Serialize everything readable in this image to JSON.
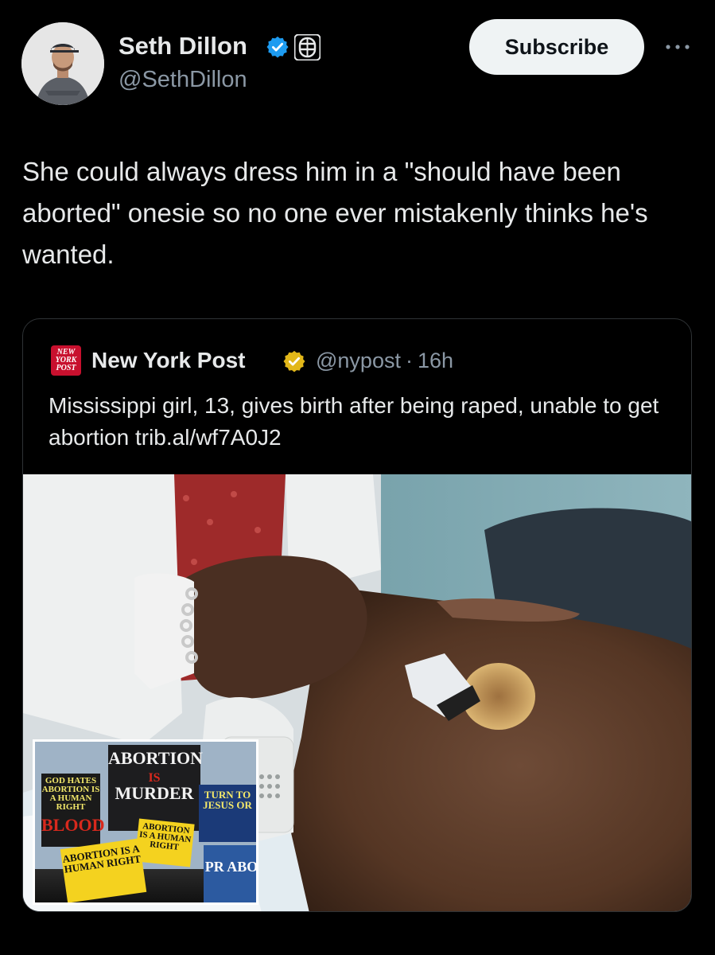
{
  "author": {
    "name": "Seth Dillon",
    "handle": "@SethDillon",
    "verified_icon": "verified-badge-blue",
    "affiliation_icon": "babylon-bee-affiliate-badge",
    "avatar": "profile-photo"
  },
  "header": {
    "subscribe_label": "Subscribe",
    "more_icon": "more-horizontal-icon"
  },
  "tweet": {
    "text": "She could always dress him in a \"should have been aborted\" onesie so no one ever mistakenly thinks he's wanted."
  },
  "quoted": {
    "logo_text": "NEW YORK POST",
    "name": "New York Post",
    "verified_icon": "verified-badge-gold",
    "handle": "@nypost",
    "separator": "·",
    "time": "16h",
    "text": "Mississippi girl, 13, gives birth after being raped, unable to get abortion trib.al/wf7A0J2",
    "image": {
      "inset_signs": {
        "main_top": "ABORTION",
        "main_mid": "IS",
        "main_bottom": "MURDER",
        "left_top": "GOD HATES",
        "left_body": "ABORTION IS A HUMAN RIGHT",
        "left_bottom": "BLOOD",
        "right": "TURN TO JESUS OR",
        "yellow_front": "ABORTION IS A HUMAN RIGHT",
        "yellow_back": "ABORTION IS A HUMAN RIGHT",
        "blue_bottom": "PR ABO"
      }
    }
  },
  "colors": {
    "background": "#000000",
    "text": "#e7e9ea",
    "muted": "#8b98a5",
    "verified_blue": "#1d9bf0",
    "verified_gold": "#e2b719",
    "nypost_red": "#c8102e"
  }
}
